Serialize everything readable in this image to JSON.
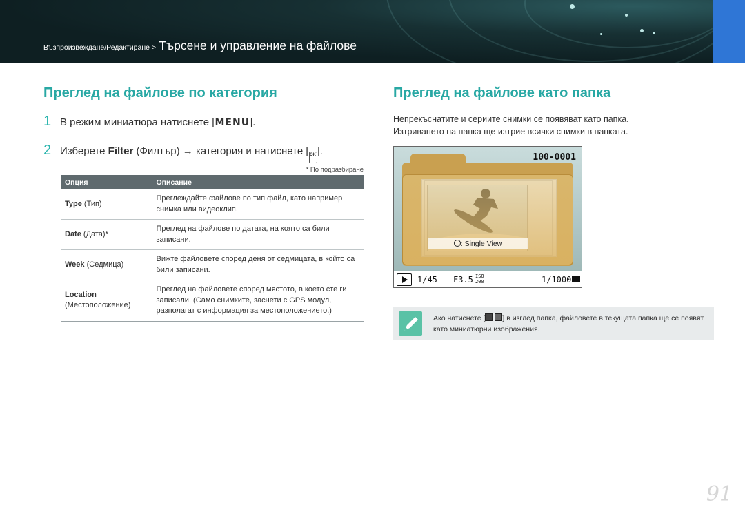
{
  "header": {
    "breadcrumb_small": "Възпроизвеждане/Редактиране >",
    "breadcrumb_big": "Търсене и управление на файлове",
    "accent_color": "#2f76d6"
  },
  "left": {
    "title": "Преглед на файлове по категория",
    "step1": {
      "num": "1",
      "text": "В режим миниатюра натиснете [",
      "key": "MENU",
      "end": "]."
    },
    "step2": {
      "num": "2",
      "text_a": "Изберете ",
      "bold": "Filter",
      "text_b": " (Филтър) → категория и натиснете [",
      "key": "OK",
      "end": "]."
    },
    "default_note": "* По подразбиране",
    "table": {
      "headers": [
        "Опция",
        "Описание"
      ],
      "rows": [
        {
          "opt_bold": "Type",
          "opt_rest": " (Тип)",
          "desc": "Преглеждайте файлове по тип файл, като например снимка или видеоклип."
        },
        {
          "opt_bold": "Date",
          "opt_rest": " (Дата)*",
          "desc": "Преглед на файлове по датата, на която са били записани."
        },
        {
          "opt_bold": "Week",
          "opt_rest": " (Седмица)",
          "desc": "Вижте файловете според деня от седмицата, в който са били записани."
        },
        {
          "opt_bold": "Location",
          "opt_rest": "(Местоположение)",
          "desc": "Преглед на файловете според мястото, в което сте ги записали. (Само снимките, заснети с GPS модул, разполагат с информация за местоположението.)"
        }
      ]
    }
  },
  "right": {
    "title": "Преглед на файлове като папка",
    "intro_line1": "Непрекъснатите и сериите снимки се появяват като папка.",
    "intro_line2": "Изтриването на папка ще изтрие всички снимки в папката.",
    "screen": {
      "folder_number": "100-0001",
      "single_view": ": Single View",
      "shutter": "1/45",
      "aperture": "F3.5",
      "iso": "ISO 200",
      "counter": "1/1000"
    },
    "note_text_a": "Ако натиснете [",
    "note_text_b": "] в изглед папка, файловете в текущата папка ще се появят като миниатюрни изображения."
  },
  "page_number": "91"
}
